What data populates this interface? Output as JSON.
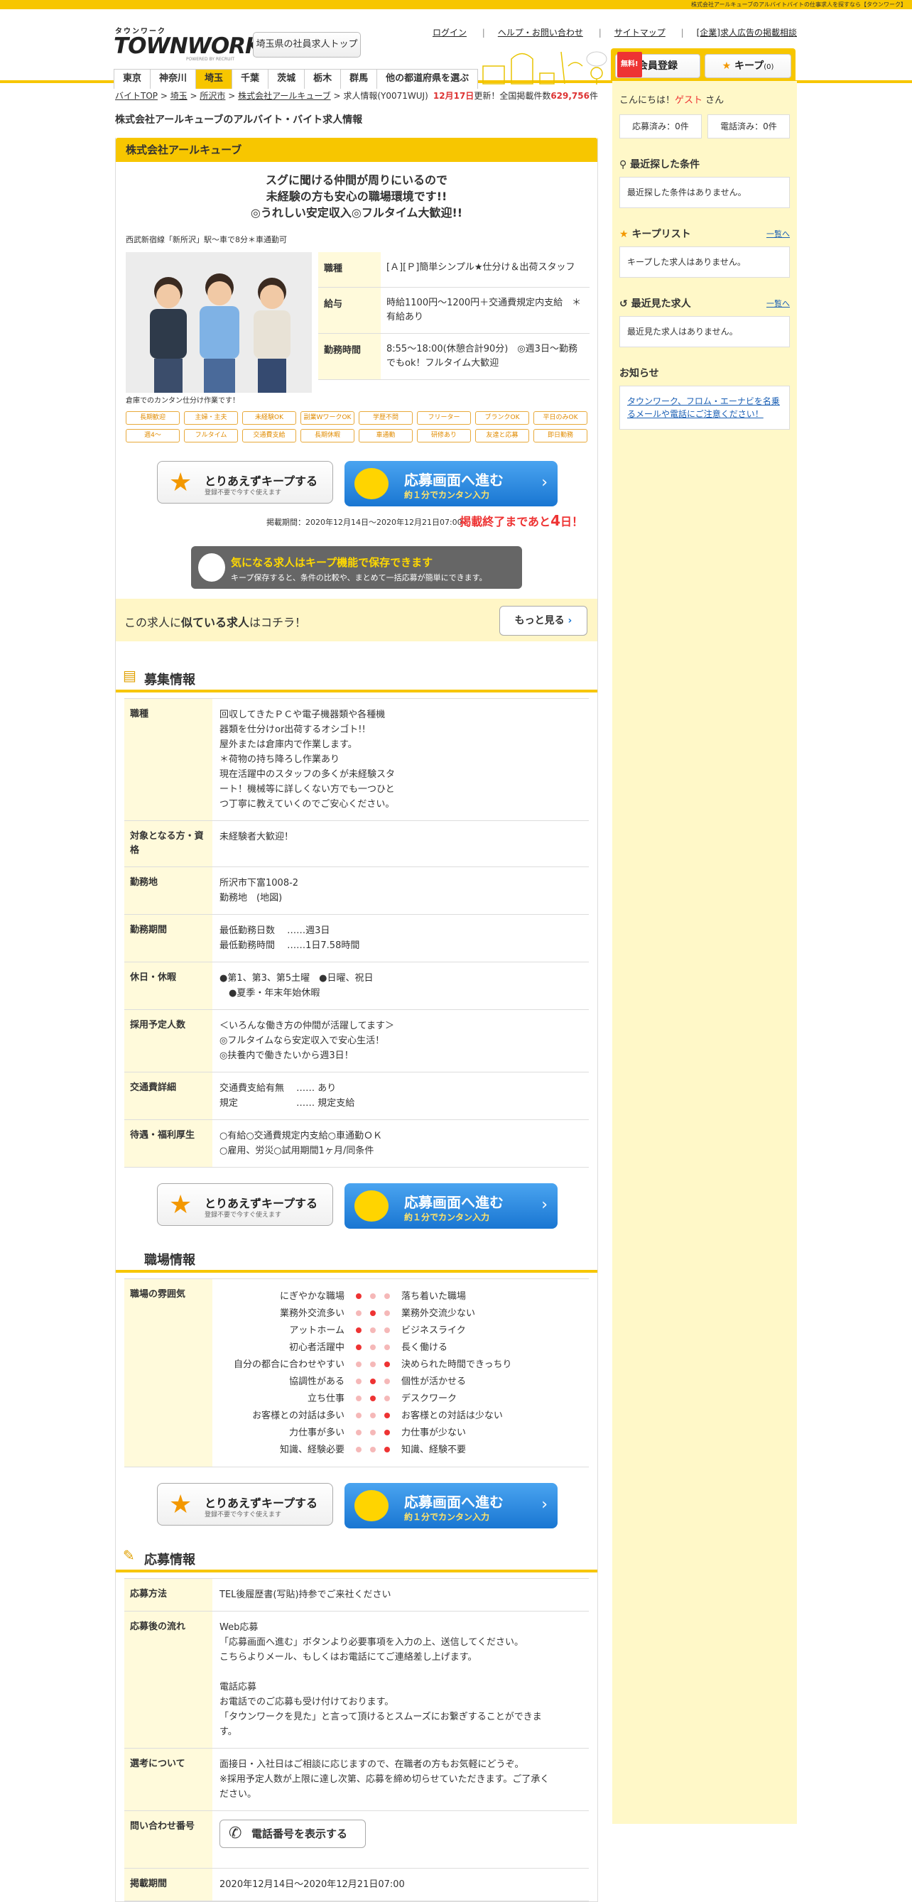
{
  "topbar": "株式会社アールキューブのアルバイトバイトの仕事求人を探すなら【タウンワーク】",
  "logo": {
    "l1": "タウンワーク",
    "l2": "TOWNWORK",
    "l3": "POWERED BY RECRUIT"
  },
  "header": {
    "top_button": "埼玉県の社員求人トップ",
    "links": [
      "ログイン",
      "ヘルプ・お問い合わせ",
      "サイトマップ",
      "[企業]求人広告の掲載相談"
    ],
    "free": "無料!",
    "member": "会員登録",
    "keep": "キープ",
    "keep_count": "(0)"
  },
  "prefs": [
    "東京",
    "神奈川",
    "埼玉",
    "千葉",
    "茨城",
    "栃木",
    "群馬",
    "他の都道府県を選ぶ"
  ],
  "breadcrumb": [
    "バイトTOP",
    "埼玉",
    "所沢市",
    "株式会社アールキューブ",
    "求人情報(Y0071WUJ)"
  ],
  "update": {
    "date": "12月17日",
    "pre": "更新！全国掲載件数",
    "count": "629,756",
    "unit": "件"
  },
  "page_title": "株式会社アールキューブのアルバイト・バイト求人情報",
  "company": "株式会社アールキューブ",
  "catch": [
    "スグに聞ける仲間が周りにいるので",
    "未経験の方も安心の職場環境です!!",
    "◎うれしい安定収入◎フルタイム大歓迎!!"
  ],
  "station": "西武新宿線「新所沢」駅～車で8分＊車通勤可",
  "photo_caption": "倉庫でのカンタン仕分け作業です！",
  "summary": [
    {
      "k": "職種",
      "v": "[Ａ][Ｐ]簡単シンプル★仕分け＆出荷スタッフ"
    },
    {
      "k": "給与",
      "v": "時給1100円～1200円＋交通費規定内支給　＊有給あり"
    },
    {
      "k": "勤務時間",
      "v": "8:55～18:00(休憩合計90分)　◎週3日～勤務でもok！フルタイム大歓迎"
    }
  ],
  "tags": [
    "長期歓迎",
    "主婦・主夫",
    "未経験OK",
    "副業WワークOK",
    "学歴不問",
    "フリーター",
    "ブランクOK",
    "平日のみOK",
    "週4～",
    "フルタイム",
    "交通費支給",
    "長期休暇",
    "車通勤",
    "研修あり",
    "友達と応募",
    "即日勤務"
  ],
  "cta": {
    "keep1": "とりあえずキープする",
    "keep2": "登録不要で今すぐ使えます",
    "apply1": "応募画面へ進む",
    "apply2": "約１分でカンタン入力"
  },
  "period": "掲載期間：2020年12月14日～2020年12月21日07:00",
  "end_pre": "掲載終了まであと",
  "end_days": "4",
  "end_post": "日！",
  "keep_banner": {
    "t1": "気になる求人はキープ機能で保存できます",
    "t2": "キープ保存すると、条件の比較や、まとめて一括応募が簡単にできます。"
  },
  "similar": {
    "pre": "この求人に",
    "bold": "似ている求人",
    "post": "はコチラ！",
    "more": "もっと見る"
  },
  "sections": {
    "recruit": "募集情報",
    "work": "職場情報",
    "apply": "応募情報"
  },
  "recruit": [
    {
      "k": "職種",
      "v": [
        "回収してきたＰＣや電子機器類や各種機",
        "器類を仕分けor出荷するオシゴト!!",
        "屋外または倉庫内で作業します。",
        "＊荷物の持ち降ろし作業あり",
        "現在活躍中のスタッフの多くが未経験スタ",
        "ート！機械等に詳しくない方でも一つひと",
        "つ丁寧に教えていくのでご安心ください。"
      ]
    },
    {
      "k": "対象となる方・資格",
      "v": [
        "未経験者大歓迎！"
      ]
    },
    {
      "k": "勤務地",
      "v": [
        "所沢市下富1008-2",
        "勤務地　(地図)"
      ]
    },
    {
      "k": "勤務期間",
      "v": [
        "最低勤務日数　 ……週3日",
        "最低勤務時間　 ……1日7.58時間"
      ]
    },
    {
      "k": "休日・休暇",
      "v": [
        "●第1、第3、第5土曜　●日曜、祝日",
        "　●夏季・年末年始休暇"
      ]
    },
    {
      "k": "採用予定人数",
      "v": [
        "＜いろんな働き方の仲間が活躍してます＞",
        "◎フルタイムなら安定収入で安心生活！",
        "◎扶養内で働きたいから週3日！"
      ]
    },
    {
      "k": "交通費詳細",
      "v": [
        "交通費支給有無　 …… あり",
        "規定　　　　　　 …… 規定支給"
      ]
    },
    {
      "k": "待遇・福利厚生",
      "v": [
        "○有給○交通費規定内支給○車通勤ＯＫ",
        "○雇用、労災○試用期間1ヶ月/同条件"
      ]
    }
  ],
  "mood_label": "職場の雰囲気",
  "mood": [
    {
      "l": "にぎやかな職場",
      "r": "落ち着いた職場",
      "pos": 0
    },
    {
      "l": "業務外交流多い",
      "r": "業務外交流少ない",
      "pos": 1
    },
    {
      "l": "アットホーム",
      "r": "ビジネスライク",
      "pos": 0
    },
    {
      "l": "初心者活躍中",
      "r": "長く働ける",
      "pos": 0
    },
    {
      "l": "自分の都合に合わせやすい",
      "r": "決められた時間できっちり",
      "pos": 2
    },
    {
      "l": "協調性がある",
      "r": "個性が活かせる",
      "pos": 1
    },
    {
      "l": "立ち仕事",
      "r": "デスクワーク",
      "pos": 1
    },
    {
      "l": "お客様との対話は多い",
      "r": "お客様との対話は少ない",
      "pos": 2
    },
    {
      "l": "力仕事が多い",
      "r": "力仕事が少ない",
      "pos": 2
    },
    {
      "l": "知識、経験必要",
      "r": "知識、経験不要",
      "pos": 2
    }
  ],
  "apply": [
    {
      "k": "応募方法",
      "v": [
        "TEL後履歴書(写貼)持参でご来社ください"
      ]
    },
    {
      "k": "応募後の流れ",
      "v": [
        "Web応募",
        "「応募画面へ進む」ボタンより必要事項を入力の上、送信してください。",
        "こちらよりメール、もしくはお電話にてご連絡差し上げます。",
        "",
        "電話応募",
        "お電話でのご応募も受け付けております。",
        "「タウンワークを見た」と言って頂けるとスムーズにお繋ぎすることができま",
        "す。"
      ]
    },
    {
      "k": "選考について",
      "v": [
        "面接日・入社日はご相談に応じますので、在職者の方もお気軽にどうぞ。",
        "※採用予定人数が上限に達し次第、応募を締め切らせていただきます。ご了承く",
        "ださい。"
      ]
    }
  ],
  "inquiry_label": "問い合わせ番号",
  "tel_button": "電話番号を表示する",
  "period_label": "掲載期間",
  "period_value": "2020年12月14日～2020年12月21日07:00",
  "side": {
    "greet_pre": "こんにちは！",
    "guest": "ゲスト",
    "greet_post": "さん",
    "applied": "応募済み：0件",
    "called": "電話済み：0件",
    "h1": "最近探した条件",
    "b1": "最近探した条件はありません。",
    "h2": "キープリスト",
    "list": "一覧へ",
    "b2": "キープした求人はありません。",
    "h3": "最近見た求人",
    "b3": "最近見た求人はありません。",
    "h4": "お知らせ",
    "b4": "タウンワーク、フロム・エーナビを名乗るメールや電話にご注意ください！"
  }
}
